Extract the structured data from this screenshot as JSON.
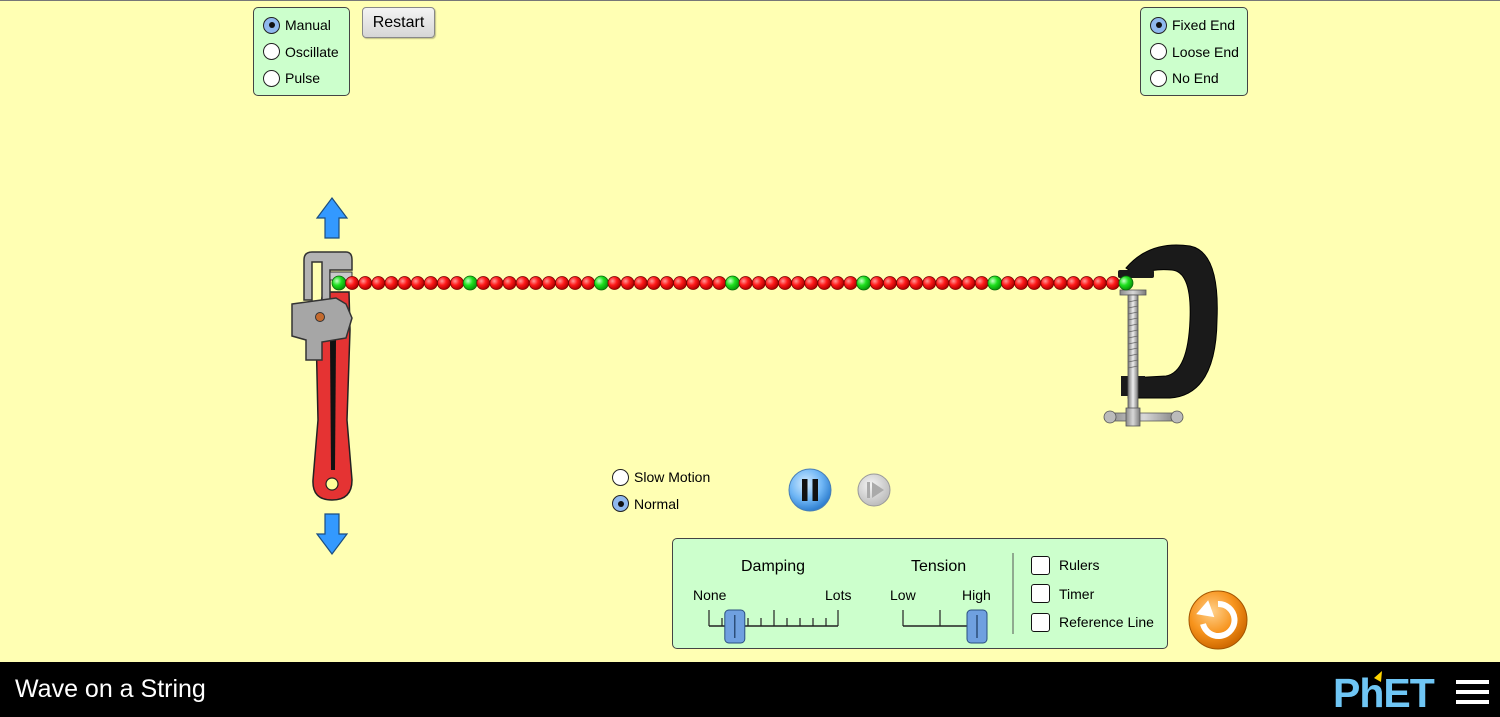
{
  "app": {
    "title": "Wave on a String"
  },
  "mode_panel": {
    "options": [
      {
        "label": "Manual",
        "selected": true
      },
      {
        "label": "Oscillate",
        "selected": false
      },
      {
        "label": "Pulse",
        "selected": false
      }
    ]
  },
  "restart_label": "Restart",
  "end_panel": {
    "options": [
      {
        "label": "Fixed End",
        "selected": true
      },
      {
        "label": "Loose End",
        "selected": false
      },
      {
        "label": "No End",
        "selected": false
      }
    ]
  },
  "speed": {
    "options": [
      {
        "label": "Slow Motion",
        "selected": false
      },
      {
        "label": "Normal",
        "selected": true
      }
    ]
  },
  "controls": {
    "damping": {
      "title": "Damping",
      "min_label": "None",
      "max_label": "Lots",
      "value": 0.2
    },
    "tension": {
      "title": "Tension",
      "min_label": "Low",
      "max_label": "High",
      "value": 1.0
    },
    "checkboxes": [
      {
        "label": "Rulers",
        "checked": false
      },
      {
        "label": "Timer",
        "checked": false
      },
      {
        "label": "Reference Line",
        "checked": false
      }
    ]
  },
  "colors": {
    "background": "#ffffb3",
    "panel": "#ccffcc",
    "bead_red": "#ff0000",
    "bead_green": "#00ee00",
    "arrow_blue": "#3399ff",
    "reset_orange": "#f7941d"
  },
  "icons": [
    "pause-icon",
    "step-icon",
    "reset-all-icon",
    "hamburger-menu-icon",
    "arrow-up-icon",
    "arrow-down-icon",
    "wrench-icon",
    "clamp-icon"
  ],
  "brand": "PhET"
}
